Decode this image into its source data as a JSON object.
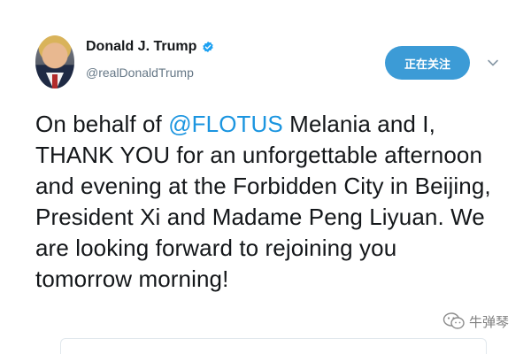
{
  "tweet": {
    "author_name": "Donald J. Trump",
    "handle": "@realDonaldTrump",
    "follow_label": "正在关注",
    "text_prefix": "On behalf of ",
    "mention": "@FLOTUS",
    "text_suffix": " Melania and I, THANK YOU for an unforgettable afternoon and evening at the Forbidden City in Beijing, President Xi and Madame Peng Liyuan. We are looking forward to rejoining you tomorrow morning!"
  },
  "watermark": {
    "text": "牛弹琴"
  },
  "icons": {
    "avatar": "profile-photo",
    "verified": "verified-badge-icon",
    "more": "chevron-down-icon",
    "watermark": "wechat-logo"
  },
  "colors": {
    "link": "#1b95e0",
    "follow_button": "#3c9bd6",
    "verified": "#1da1f2",
    "text": "#14171a",
    "secondary": "#657786"
  }
}
